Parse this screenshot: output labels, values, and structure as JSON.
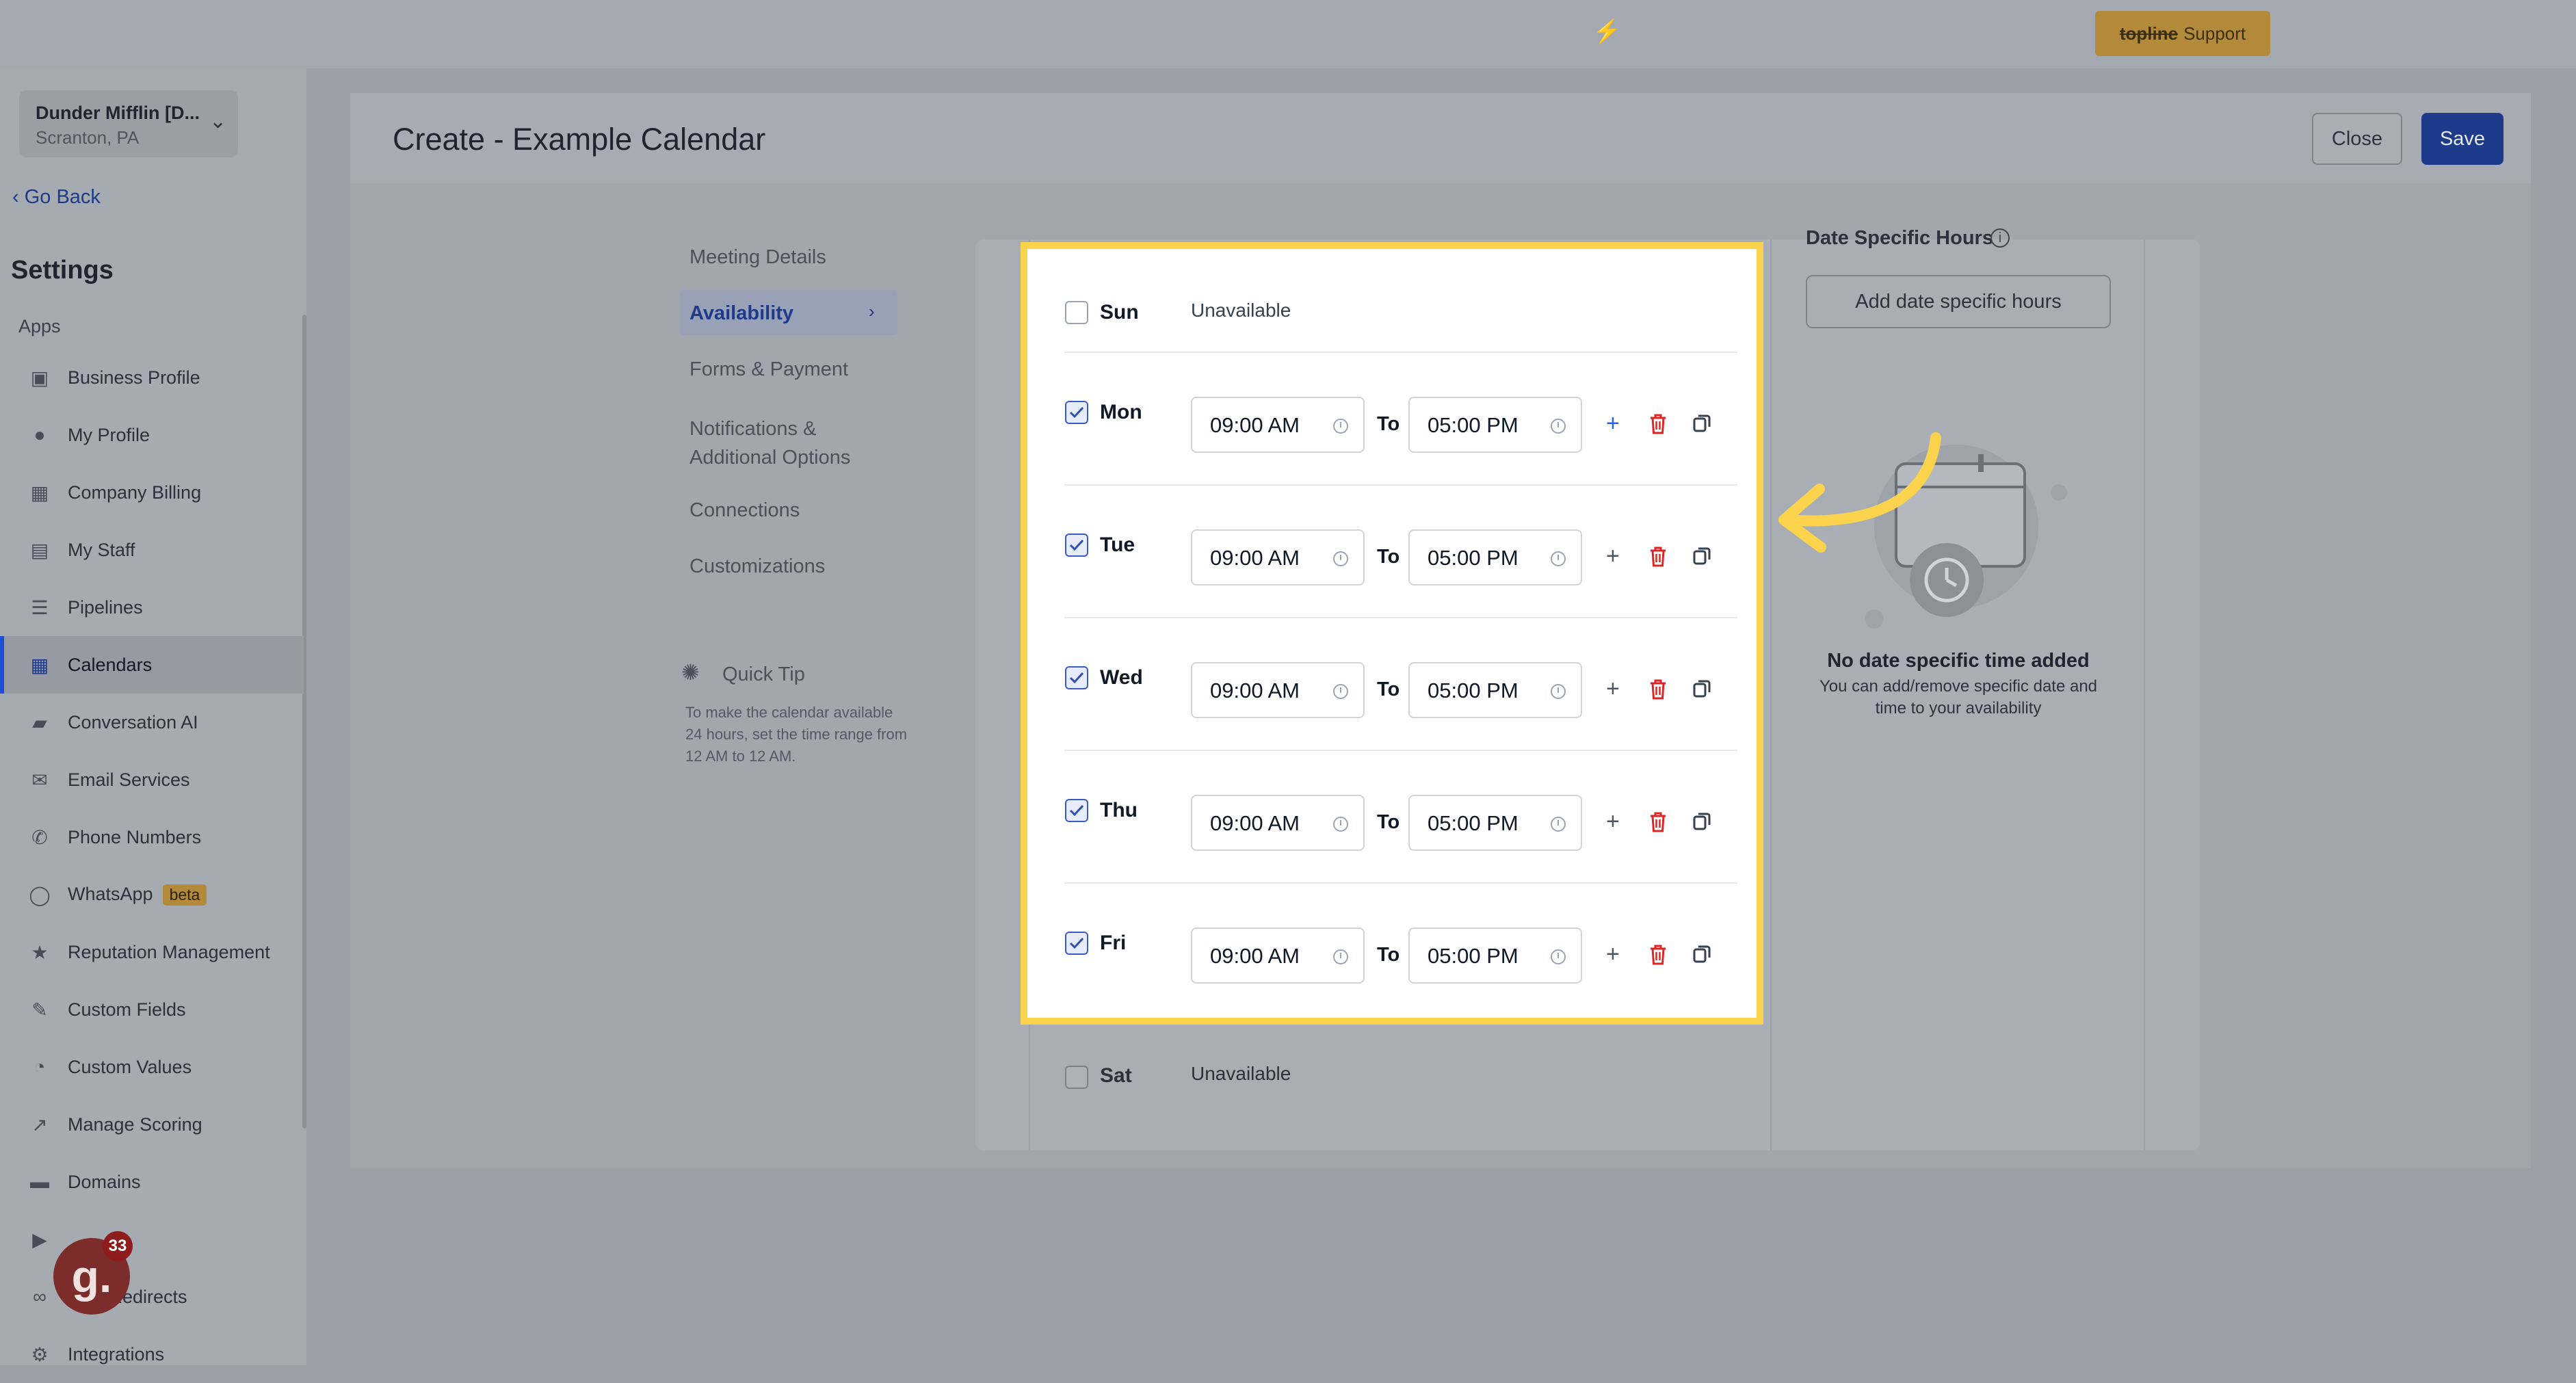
{
  "topbar": {
    "support_brand": "topline",
    "support_label": "Support"
  },
  "sidebar": {
    "location": {
      "name": "Dunder Mifflin [D...",
      "address": "Scranton, PA"
    },
    "go_back": "Go Back",
    "title": "Settings",
    "section": "Apps",
    "items": [
      {
        "label": "Business Profile",
        "icon": "briefcase-icon"
      },
      {
        "label": "My Profile",
        "icon": "person-icon"
      },
      {
        "label": "Company Billing",
        "icon": "grid-icon"
      },
      {
        "label": "My Staff",
        "icon": "staff-icon"
      },
      {
        "label": "Pipelines",
        "icon": "filter-icon"
      },
      {
        "label": "Calendars",
        "icon": "calendar-icon",
        "active": true
      },
      {
        "label": "Conversation AI",
        "icon": "chat-icon"
      },
      {
        "label": "Email Services",
        "icon": "mail-icon"
      },
      {
        "label": "Phone Numbers",
        "icon": "phone-icon"
      },
      {
        "label": "WhatsApp",
        "icon": "whatsapp-icon",
        "badge": "beta"
      },
      {
        "label": "Reputation Management",
        "icon": "star-icon"
      },
      {
        "label": "Custom Fields",
        "icon": "fields-icon"
      },
      {
        "label": "Custom Values",
        "icon": "pie-icon"
      },
      {
        "label": "Manage Scoring",
        "icon": "chart-icon"
      },
      {
        "label": "Domains",
        "icon": "domain-icon"
      },
      {
        "label": "",
        "icon": "video-icon"
      },
      {
        "label": "URL Redirects",
        "icon": "link-icon"
      },
      {
        "label": "Integrations",
        "icon": "integrations-icon"
      }
    ],
    "notifications_count": "33",
    "helper_letter": "g."
  },
  "header": {
    "title": "Create - Example Calendar",
    "close": "Close",
    "save": "Save"
  },
  "tabs": [
    {
      "label": "Meeting Details"
    },
    {
      "label": "Availability",
      "active": true
    },
    {
      "label": "Forms & Payment"
    },
    {
      "label": "Notifications & Additional Options"
    },
    {
      "label": "Connections"
    },
    {
      "label": "Customizations"
    }
  ],
  "quick_tip": {
    "title": "Quick Tip",
    "text": "To make the calendar available 24 hours, set the time range from 12 AM to 12 AM."
  },
  "availability": {
    "to_label": "To",
    "unavailable_label": "Unavailable",
    "days": [
      {
        "day": "Sun",
        "enabled": false,
        "status": "Unavailable"
      },
      {
        "day": "Mon",
        "enabled": true,
        "start": "09:00 AM",
        "end": "05:00 PM"
      },
      {
        "day": "Tue",
        "enabled": true,
        "start": "09:00 AM",
        "end": "05:00 PM"
      },
      {
        "day": "Wed",
        "enabled": true,
        "start": "09:00 AM",
        "end": "05:00 PM"
      },
      {
        "day": "Thu",
        "enabled": true,
        "start": "09:00 AM",
        "end": "05:00 PM"
      },
      {
        "day": "Fri",
        "enabled": true,
        "start": "09:00 AM",
        "end": "05:00 PM"
      },
      {
        "day": "Sat",
        "enabled": false,
        "status": "Unavailable"
      }
    ]
  },
  "date_specific": {
    "title": "Date Specific Hours",
    "add_button": "Add date specific hours",
    "empty_title": "No date specific time added",
    "empty_text": "You can add/remove specific date and time to your availability"
  },
  "colors": {
    "highlight": "#fcd34d",
    "accent": "#1e3a8a",
    "danger": "#dc2626"
  }
}
